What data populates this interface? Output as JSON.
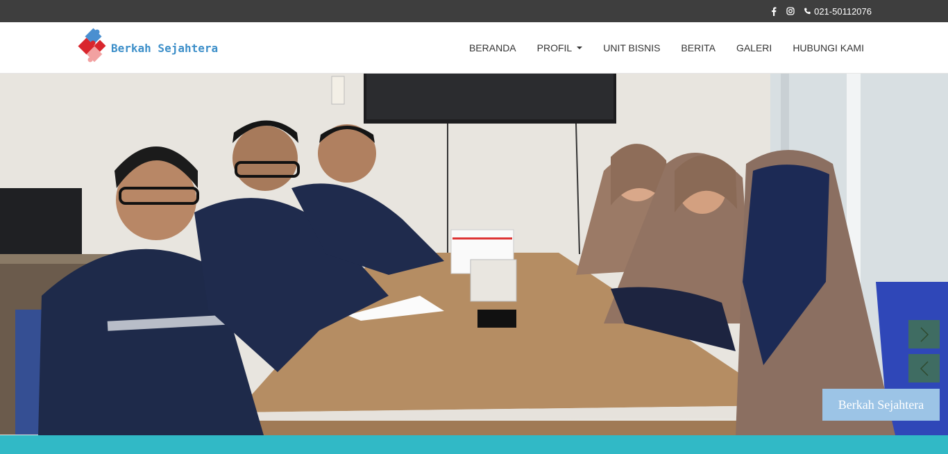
{
  "topbar": {
    "facebook_icon": "facebook-icon",
    "instagram_icon": "instagram-icon",
    "phone_icon": "phone-icon",
    "phone": "021-50112076"
  },
  "logo": {
    "brand": "Berkah Sejahtera"
  },
  "menu": {
    "items": [
      {
        "label": "BERANDA"
      },
      {
        "label": "PROFIL",
        "has_dropdown": true
      },
      {
        "label": "UNIT BISNIS"
      },
      {
        "label": "BERITA"
      },
      {
        "label": "GALERI"
      },
      {
        "label": "HUBUNGI KAMI"
      }
    ]
  },
  "slider": {
    "caption": "Berkah Sejahtera",
    "next_icon": "chevron-right-icon",
    "prev_icon": "chevron-left-icon"
  },
  "colors": {
    "topbar": "#3e3e3e",
    "brand_blue": "#3d8fc9",
    "teal_band": "#31b9c6",
    "caption_bg": "#9cc4e6"
  }
}
